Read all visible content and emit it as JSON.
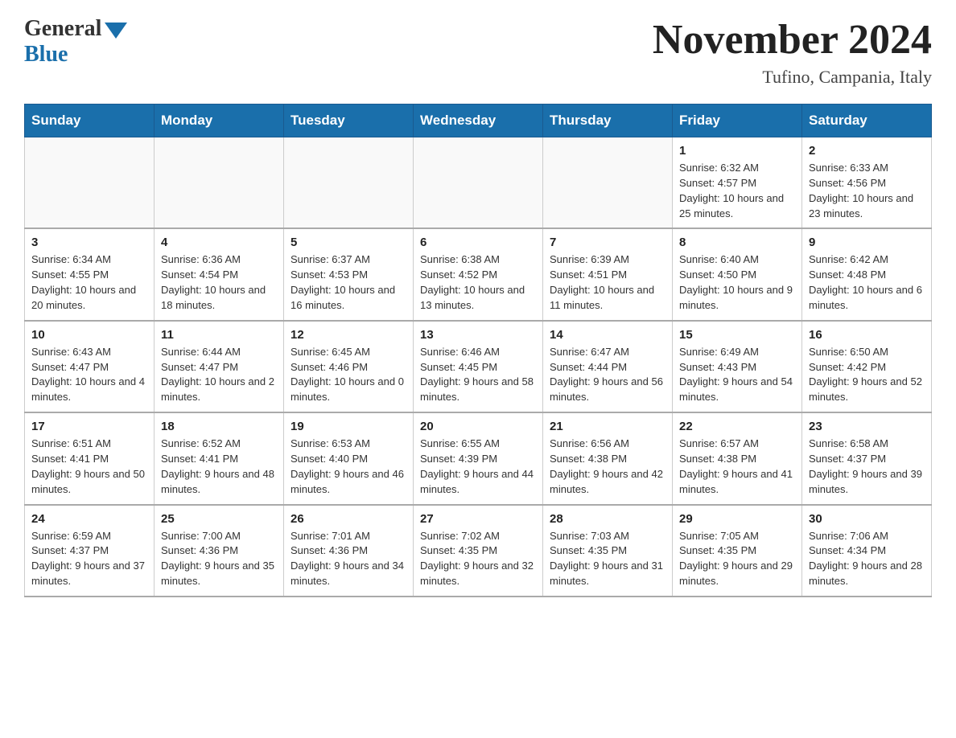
{
  "header": {
    "logo_general": "General",
    "logo_blue": "Blue",
    "month_title": "November 2024",
    "location": "Tufino, Campania, Italy"
  },
  "days_of_week": [
    "Sunday",
    "Monday",
    "Tuesday",
    "Wednesday",
    "Thursday",
    "Friday",
    "Saturday"
  ],
  "weeks": [
    [
      {
        "day": "",
        "info": ""
      },
      {
        "day": "",
        "info": ""
      },
      {
        "day": "",
        "info": ""
      },
      {
        "day": "",
        "info": ""
      },
      {
        "day": "",
        "info": ""
      },
      {
        "day": "1",
        "info": "Sunrise: 6:32 AM\nSunset: 4:57 PM\nDaylight: 10 hours and 25 minutes."
      },
      {
        "day": "2",
        "info": "Sunrise: 6:33 AM\nSunset: 4:56 PM\nDaylight: 10 hours and 23 minutes."
      }
    ],
    [
      {
        "day": "3",
        "info": "Sunrise: 6:34 AM\nSunset: 4:55 PM\nDaylight: 10 hours and 20 minutes."
      },
      {
        "day": "4",
        "info": "Sunrise: 6:36 AM\nSunset: 4:54 PM\nDaylight: 10 hours and 18 minutes."
      },
      {
        "day": "5",
        "info": "Sunrise: 6:37 AM\nSunset: 4:53 PM\nDaylight: 10 hours and 16 minutes."
      },
      {
        "day": "6",
        "info": "Sunrise: 6:38 AM\nSunset: 4:52 PM\nDaylight: 10 hours and 13 minutes."
      },
      {
        "day": "7",
        "info": "Sunrise: 6:39 AM\nSunset: 4:51 PM\nDaylight: 10 hours and 11 minutes."
      },
      {
        "day": "8",
        "info": "Sunrise: 6:40 AM\nSunset: 4:50 PM\nDaylight: 10 hours and 9 minutes."
      },
      {
        "day": "9",
        "info": "Sunrise: 6:42 AM\nSunset: 4:48 PM\nDaylight: 10 hours and 6 minutes."
      }
    ],
    [
      {
        "day": "10",
        "info": "Sunrise: 6:43 AM\nSunset: 4:47 PM\nDaylight: 10 hours and 4 minutes."
      },
      {
        "day": "11",
        "info": "Sunrise: 6:44 AM\nSunset: 4:47 PM\nDaylight: 10 hours and 2 minutes."
      },
      {
        "day": "12",
        "info": "Sunrise: 6:45 AM\nSunset: 4:46 PM\nDaylight: 10 hours and 0 minutes."
      },
      {
        "day": "13",
        "info": "Sunrise: 6:46 AM\nSunset: 4:45 PM\nDaylight: 9 hours and 58 minutes."
      },
      {
        "day": "14",
        "info": "Sunrise: 6:47 AM\nSunset: 4:44 PM\nDaylight: 9 hours and 56 minutes."
      },
      {
        "day": "15",
        "info": "Sunrise: 6:49 AM\nSunset: 4:43 PM\nDaylight: 9 hours and 54 minutes."
      },
      {
        "day": "16",
        "info": "Sunrise: 6:50 AM\nSunset: 4:42 PM\nDaylight: 9 hours and 52 minutes."
      }
    ],
    [
      {
        "day": "17",
        "info": "Sunrise: 6:51 AM\nSunset: 4:41 PM\nDaylight: 9 hours and 50 minutes."
      },
      {
        "day": "18",
        "info": "Sunrise: 6:52 AM\nSunset: 4:41 PM\nDaylight: 9 hours and 48 minutes."
      },
      {
        "day": "19",
        "info": "Sunrise: 6:53 AM\nSunset: 4:40 PM\nDaylight: 9 hours and 46 minutes."
      },
      {
        "day": "20",
        "info": "Sunrise: 6:55 AM\nSunset: 4:39 PM\nDaylight: 9 hours and 44 minutes."
      },
      {
        "day": "21",
        "info": "Sunrise: 6:56 AM\nSunset: 4:38 PM\nDaylight: 9 hours and 42 minutes."
      },
      {
        "day": "22",
        "info": "Sunrise: 6:57 AM\nSunset: 4:38 PM\nDaylight: 9 hours and 41 minutes."
      },
      {
        "day": "23",
        "info": "Sunrise: 6:58 AM\nSunset: 4:37 PM\nDaylight: 9 hours and 39 minutes."
      }
    ],
    [
      {
        "day": "24",
        "info": "Sunrise: 6:59 AM\nSunset: 4:37 PM\nDaylight: 9 hours and 37 minutes."
      },
      {
        "day": "25",
        "info": "Sunrise: 7:00 AM\nSunset: 4:36 PM\nDaylight: 9 hours and 35 minutes."
      },
      {
        "day": "26",
        "info": "Sunrise: 7:01 AM\nSunset: 4:36 PM\nDaylight: 9 hours and 34 minutes."
      },
      {
        "day": "27",
        "info": "Sunrise: 7:02 AM\nSunset: 4:35 PM\nDaylight: 9 hours and 32 minutes."
      },
      {
        "day": "28",
        "info": "Sunrise: 7:03 AM\nSunset: 4:35 PM\nDaylight: 9 hours and 31 minutes."
      },
      {
        "day": "29",
        "info": "Sunrise: 7:05 AM\nSunset: 4:35 PM\nDaylight: 9 hours and 29 minutes."
      },
      {
        "day": "30",
        "info": "Sunrise: 7:06 AM\nSunset: 4:34 PM\nDaylight: 9 hours and 28 minutes."
      }
    ]
  ]
}
